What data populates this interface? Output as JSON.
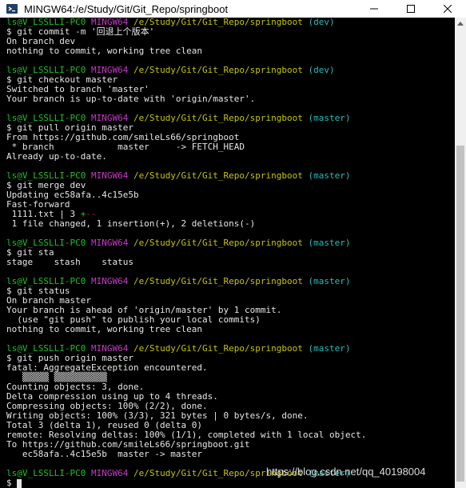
{
  "window": {
    "title": "MINGW64:/e/Study/Git/Git_Repo/springboot",
    "icons": {
      "app": "mingw-terminal-icon",
      "minimize": "minimize-icon",
      "maximize": "maximize-icon",
      "close": "close-icon"
    }
  },
  "terminal": {
    "colors": {
      "background": "#000000",
      "text": "#e6e6e6",
      "user": "#1dc121",
      "shell": "#c839c5",
      "path": "#c7c400",
      "branch": "#25bcbc"
    },
    "lines": [
      {
        "type": "prompt",
        "user": "ls@V_LSSLLI-PC0",
        "shell": "MINGW64",
        "path": "/e/Study/Git/Git_Repo/springboot",
        "branch": "(dev)"
      },
      {
        "type": "text",
        "text": "$ git commit -m '回退上个版本'"
      },
      {
        "type": "text",
        "text": "On branch dev"
      },
      {
        "type": "text",
        "text": "nothing to commit, working tree clean"
      },
      {
        "type": "blank"
      },
      {
        "type": "prompt",
        "user": "ls@V_LSSLLI-PC0",
        "shell": "MINGW64",
        "path": "/e/Study/Git/Git_Repo/springboot",
        "branch": "(dev)"
      },
      {
        "type": "text",
        "text": "$ git checkout master"
      },
      {
        "type": "text",
        "text": "Switched to branch 'master'"
      },
      {
        "type": "text",
        "text": "Your branch is up-to-date with 'origin/master'."
      },
      {
        "type": "blank"
      },
      {
        "type": "prompt",
        "user": "ls@V_LSSLLI-PC0",
        "shell": "MINGW64",
        "path": "/e/Study/Git/Git_Repo/springboot",
        "branch": "(master)"
      },
      {
        "type": "text",
        "text": "$ git pull origin master"
      },
      {
        "type": "text",
        "text": "From https://github.com/smileLs66/springboot"
      },
      {
        "type": "text",
        "text": " * branch            master     -> FETCH_HEAD"
      },
      {
        "type": "text",
        "text": "Already up-to-date."
      },
      {
        "type": "blank"
      },
      {
        "type": "prompt",
        "user": "ls@V_LSSLLI-PC0",
        "shell": "MINGW64",
        "path": "/e/Study/Git/Git_Repo/springboot",
        "branch": "(master)"
      },
      {
        "type": "text",
        "text": "$ git merge dev"
      },
      {
        "type": "text",
        "text": "Updating ec58afa..4c15e5b"
      },
      {
        "type": "text",
        "text": "Fast-forward"
      },
      {
        "type": "stat",
        "text": " 1111.txt | 3 ",
        "plus": "+",
        "minus": "--"
      },
      {
        "type": "text",
        "text": " 1 file changed, 1 insertion(+), 2 deletions(-)"
      },
      {
        "type": "blank"
      },
      {
        "type": "prompt",
        "user": "ls@V_LSSLLI-PC0",
        "shell": "MINGW64",
        "path": "/e/Study/Git/Git_Repo/springboot",
        "branch": "(master)"
      },
      {
        "type": "text",
        "text": "$ git sta"
      },
      {
        "type": "text",
        "text": "stage    stash    status"
      },
      {
        "type": "blank"
      },
      {
        "type": "prompt",
        "user": "ls@V_LSSLLI-PC0",
        "shell": "MINGW64",
        "path": "/e/Study/Git/Git_Repo/springboot",
        "branch": "(master)"
      },
      {
        "type": "text",
        "text": "$ git status"
      },
      {
        "type": "text",
        "text": "On branch master"
      },
      {
        "type": "text",
        "text": "Your branch is ahead of 'origin/master' by 1 commit."
      },
      {
        "type": "text",
        "text": "  (use \"git push\" to publish your local commits)"
      },
      {
        "type": "text",
        "text": "nothing to commit, working tree clean"
      },
      {
        "type": "blank"
      },
      {
        "type": "prompt",
        "user": "ls@V_LSSLLI-PC0",
        "shell": "MINGW64",
        "path": "/e/Study/Git/Git_Repo/springboot",
        "branch": "(master)"
      },
      {
        "type": "text",
        "text": "$ git push origin master"
      },
      {
        "type": "text",
        "text": "fatal: AggregateException encountered."
      },
      {
        "type": "text",
        "text": "   ▒▒▒▒▒ ▒▒▒▒▒▒▒▒▒▒"
      },
      {
        "type": "text",
        "text": "Counting objects: 3, done."
      },
      {
        "type": "text",
        "text": "Delta compression using up to 4 threads."
      },
      {
        "type": "text",
        "text": "Compressing objects: 100% (2/2), done."
      },
      {
        "type": "text",
        "text": "Writing objects: 100% (3/3), 321 bytes | 0 bytes/s, done."
      },
      {
        "type": "text",
        "text": "Total 3 (delta 1), reused 0 (delta 0)"
      },
      {
        "type": "text",
        "text": "remote: Resolving deltas: 100% (1/1), completed with 1 local object."
      },
      {
        "type": "text",
        "text": "To https://github.com/smileLs66/springboot.git"
      },
      {
        "type": "text",
        "text": "   ec58afa..4c15e5b  master -> master"
      },
      {
        "type": "blank"
      },
      {
        "type": "prompt",
        "user": "ls@V_LSSLLI-PC0",
        "shell": "MINGW64",
        "path": "/e/Study/Git/Git_Repo/springboot",
        "branch": "(master)"
      },
      {
        "type": "input",
        "text": "$ "
      }
    ]
  },
  "watermark": "https://blog.csdn.net/qq_40198004",
  "scrollbar": {
    "up_icon": "scroll-up-arrow-icon",
    "down_icon": "scroll-down-arrow-icon"
  }
}
